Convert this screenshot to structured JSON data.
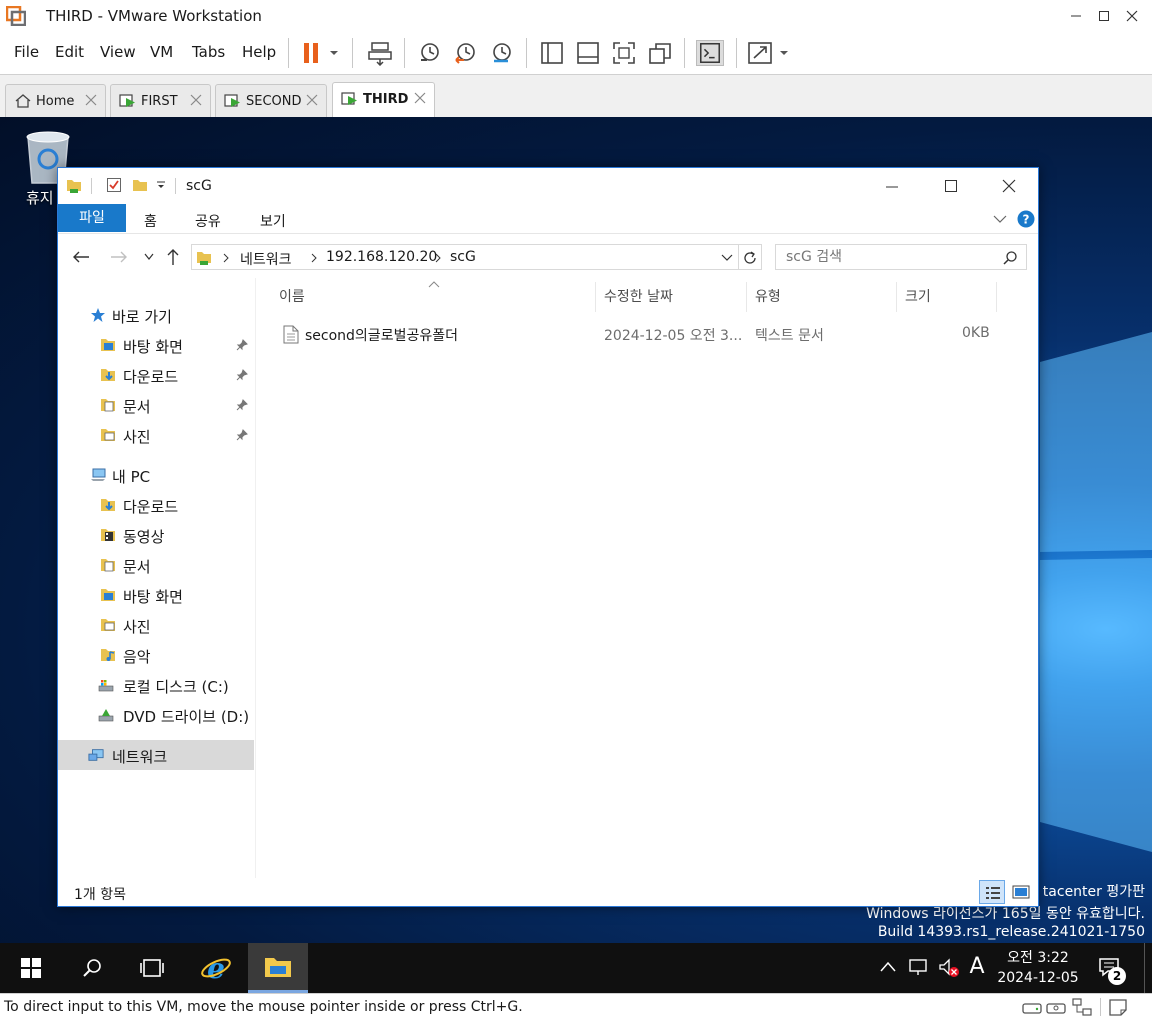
{
  "vmware": {
    "title": "THIRD - VMware Workstation",
    "menu": [
      "File",
      "Edit",
      "View",
      "VM",
      "Tabs",
      "Help"
    ],
    "tabs": [
      {
        "label": "Home"
      },
      {
        "label": "FIRST"
      },
      {
        "label": "SECOND"
      },
      {
        "label": "THIRD"
      }
    ],
    "status": "To direct input to this VM, move the mouse pointer inside or press Ctrl+G."
  },
  "desktop": {
    "recycle_label": "휴지",
    "watermark_line1": "tacenter 평가판",
    "watermark_line2": "Windows 라이선스가 165일 동안 유효합니다.",
    "watermark_line3": "Build 14393.rs1_release.241021-1750"
  },
  "explorer": {
    "title": "scG",
    "ribbon": {
      "file": "파일",
      "home": "홈",
      "share": "공유",
      "view": "보기"
    },
    "breadcrumb": [
      "네트워크",
      "192.168.120.20",
      "scG"
    ],
    "search_placeholder": "scG 검색",
    "nav": {
      "quick_access": "바로 가기",
      "qa_items": [
        "바탕 화면",
        "다운로드",
        "문서",
        "사진"
      ],
      "this_pc": "내 PC",
      "pc_items": [
        "다운로드",
        "동영상",
        "문서",
        "바탕 화면",
        "사진",
        "음악",
        "로컬 디스크 (C:)",
        "DVD 드라이브 (D:)"
      ],
      "network": "네트워크"
    },
    "columns": {
      "name": "이름",
      "modified": "수정한 날짜",
      "type": "유형",
      "size": "크기"
    },
    "files": [
      {
        "name": "second의글로벌공유폴더",
        "modified": "2024-12-05 오전 3...",
        "type": "텍스트 문서",
        "size": "0KB"
      }
    ],
    "status": "1개 항목"
  },
  "taskbar": {
    "time": "오전 3:22",
    "date": "2024-12-05",
    "ime": "A",
    "notifications": "2"
  }
}
